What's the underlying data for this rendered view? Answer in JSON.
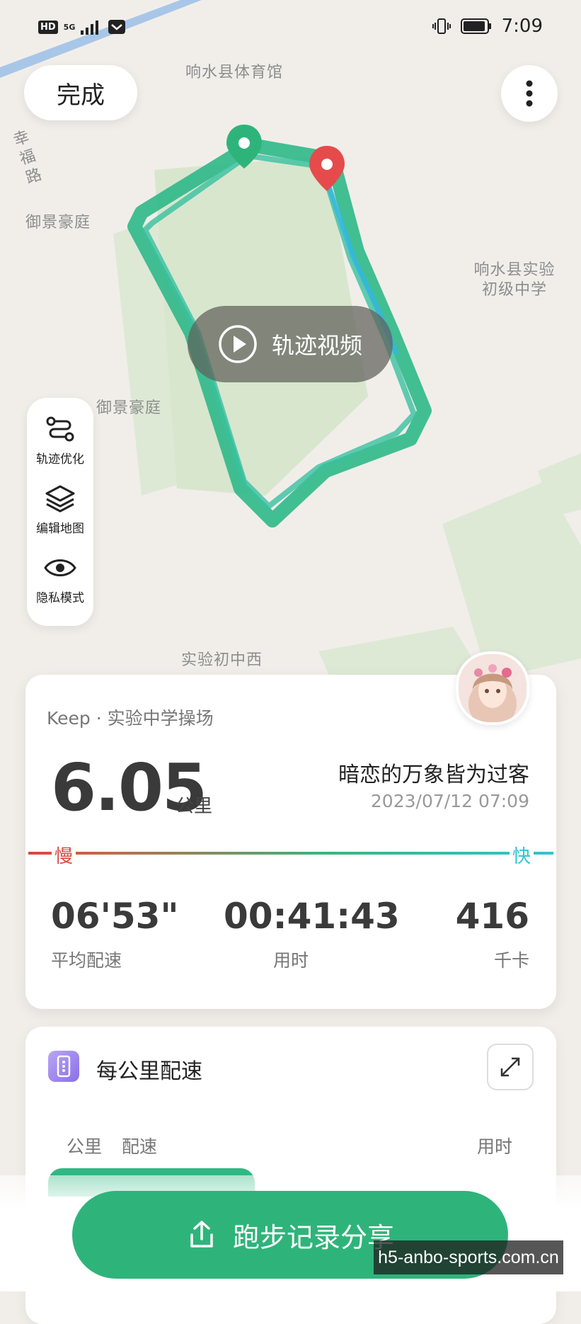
{
  "status_bar": {
    "network": "HD",
    "signal_type": "5G",
    "time": "7:09"
  },
  "toolbar": {
    "done_label": "完成",
    "more_icon": "more-vertical-icon"
  },
  "map": {
    "labels": [
      "响水县体育馆",
      "幸福路",
      "御景豪庭",
      "响水县实验初级中学",
      "御景豪庭",
      "实验初中西"
    ],
    "video_label": "轨迹视频",
    "track_color": "#2fb88a"
  },
  "tools": [
    {
      "label": "轨迹优化",
      "icon": "route-icon"
    },
    {
      "label": "编辑地图",
      "icon": "layers-icon"
    },
    {
      "label": "隐私模式",
      "icon": "eye-icon"
    }
  ],
  "summary": {
    "place": "Keep · 实验中学操场",
    "distance": "6.05",
    "distance_unit": "公里",
    "user": "暗恋的万象皆为过客",
    "date": "2023/07/12 07:09",
    "slow_label": "慢",
    "fast_label": "快",
    "stats": [
      {
        "value": "06'53\"",
        "label": "平均配速"
      },
      {
        "value": "00:41:43",
        "label": "用时"
      },
      {
        "value": "416",
        "label": "千卡"
      }
    ]
  },
  "splits": {
    "title": "每公里配速",
    "col_km": "公里",
    "col_pace": "配速",
    "col_time": "用时"
  },
  "share": {
    "label": "跑步记录分享"
  },
  "watermark": "h5-anbo-sports.com.cn",
  "colors": {
    "accent": "#2eb47a",
    "slow": "#d9463f",
    "fast": "#30c4d0",
    "start_pin": "#2eb47a",
    "end_pin": "#e54b4b"
  }
}
